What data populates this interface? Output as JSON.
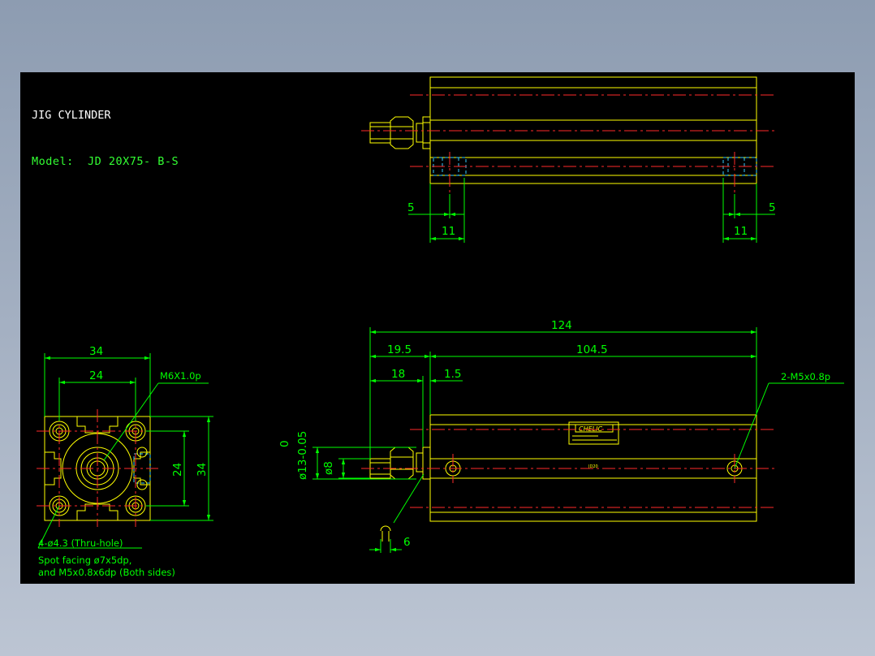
{
  "title": {
    "line1": "JIG CYLINDER",
    "line2": "Model:  JD 20X75- B-S"
  },
  "top_view_dims": {
    "left_small": "5",
    "left_large": "11",
    "right_small": "5",
    "right_large": "11"
  },
  "end_view_dims": {
    "width_outer": "34",
    "width_inner": "24",
    "height_outer": "34",
    "height_inner": "24",
    "thread_callout": "M6X1.0p",
    "holes_note": "4-ø4.3 (Thru-hole)",
    "spot_note_1": "Spot facing ø7x5dp,",
    "spot_note_2": "and M5x0.8x6dp (Both sides)"
  },
  "side_view_dims": {
    "overall": "124",
    "rod_extension": "19.5",
    "body_length": "104.5",
    "rod_to_face": "18",
    "flange": "1.5",
    "port_callout": "2-M5x0.8p",
    "rod_dia_tol_top": "0",
    "rod_dia_tol": "ø13-0.05",
    "rod_dia": "ø8",
    "wrench": "6"
  },
  "label_plate": {
    "brand": "CHELIC",
    "body_mark": "JD20"
  },
  "colors": {
    "background": "#000000",
    "outline": "#ffff00",
    "dimension": "#00ff00",
    "centerline": "#ff2a2a",
    "hidden": "#33ccff"
  }
}
